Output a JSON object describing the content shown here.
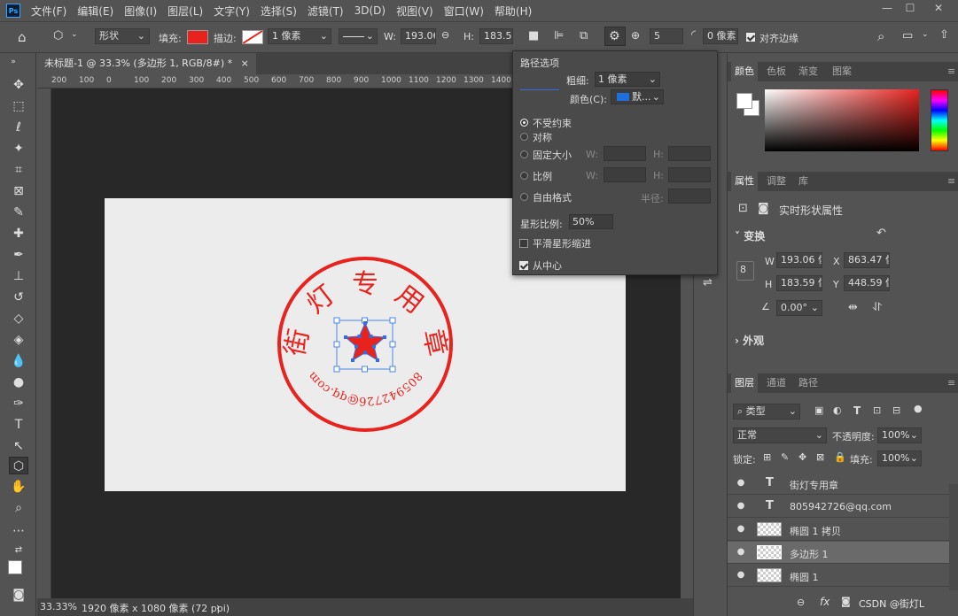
{
  "app": {
    "logo_text": "Ps"
  },
  "menu": [
    "文件(F)",
    "编辑(E)",
    "图像(I)",
    "图层(L)",
    "文字(Y)",
    "选择(S)",
    "滤镜(T)",
    "3D(D)",
    "视图(V)",
    "窗口(W)",
    "帮助(H)"
  ],
  "window_controls": {
    "minimize": "—",
    "maximize": "☐",
    "close": "✕"
  },
  "options": {
    "mode": "形状",
    "fill_label": "填充:",
    "fill_color": "#e8231e",
    "stroke_label": "描边:",
    "stroke_width": "1 像素",
    "w_label": "W:",
    "w_value": "193.06",
    "h_label": "H:",
    "h_value": "183.59",
    "sides": "5",
    "radius": "0 像素",
    "align_edges": "对齐边缘"
  },
  "document": {
    "tab_title": "未标题-1 @ 33.3% (多边形 1, RGB/8#) *",
    "zoom": "33.33%",
    "info": "1920 像素 x 1080 像素 (72 ppi)",
    "stamp": {
      "chars": [
        "街",
        "灯",
        "专",
        "用",
        "章"
      ],
      "email": "805942726@qq.com",
      "color": "#e8231e"
    }
  },
  "ruler": [
    "200",
    "100",
    "0",
    "100",
    "200",
    "300",
    "400",
    "500",
    "600",
    "700",
    "800",
    "900",
    "1000",
    "1100",
    "1200",
    "1300",
    "1400"
  ],
  "path_options": {
    "title": "路径选项",
    "thickness_label": "粗细:",
    "thickness": "1 像素",
    "color_label": "颜色(C):",
    "color_value": "默...",
    "color_swatch": "#1e6fd9",
    "unconstrained": "不受约束",
    "symmetric": "对称",
    "fixed_size": "固定大小",
    "proportion": "比例",
    "freeform": "自由格式",
    "w_label": "W:",
    "h_label": "H:",
    "radius_label": "半径:",
    "star_ratio_label": "星形比例:",
    "star_ratio": "50%",
    "smooth_indents": "平滑星形缩进",
    "from_center": "从中心"
  },
  "color_panel": {
    "tabs": [
      "颜色",
      "色板",
      "渐变",
      "图案"
    ]
  },
  "properties": {
    "tabs": [
      "属性",
      "调整",
      "库"
    ],
    "header": "实时形状属性",
    "transform": "变换",
    "w_label": "W",
    "w": "193.06 像",
    "h_label": "H",
    "h": "183.59 像",
    "x_label": "X",
    "x": "863.47 像",
    "y_label": "Y",
    "y": "448.59 像",
    "angle": "0.00°",
    "appearance": "外观"
  },
  "layers_panel": {
    "tabs": [
      "图层",
      "通道",
      "路径"
    ],
    "filter": "类型",
    "blend": "正常",
    "opacity_label": "不透明度:",
    "opacity": "100%",
    "lock_label": "锁定:",
    "fill_label": "填充:",
    "fill": "100%",
    "layers": [
      {
        "name": "街灯专用章",
        "kind": "text",
        "selected": false
      },
      {
        "name": "805942726@qq.com",
        "kind": "text",
        "selected": false
      },
      {
        "name": "椭圆 1 拷贝",
        "kind": "shape",
        "selected": false
      },
      {
        "name": "多边形 1",
        "kind": "shape",
        "selected": true
      },
      {
        "name": "椭圆 1",
        "kind": "shape",
        "selected": false
      }
    ]
  },
  "watermark": "CSDN @街灯L"
}
